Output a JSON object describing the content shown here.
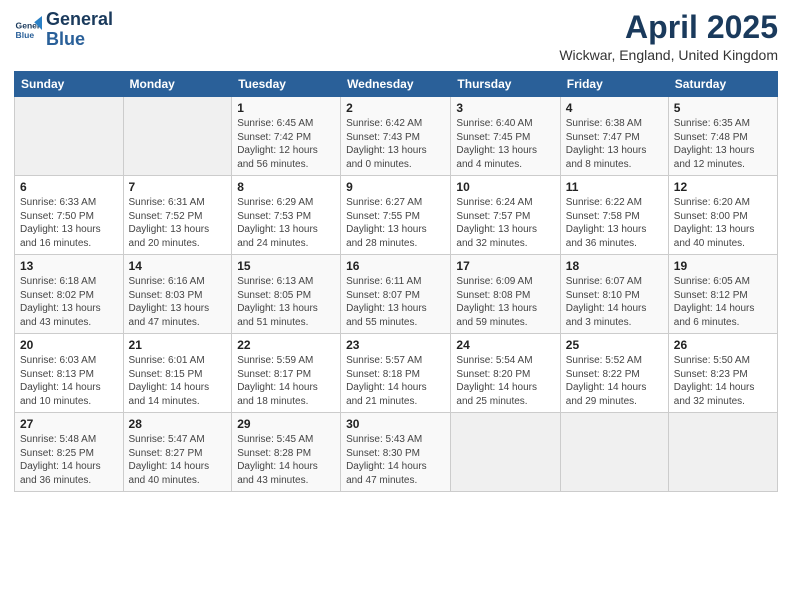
{
  "header": {
    "logo_line1": "General",
    "logo_line2": "Blue",
    "title": "April 2025",
    "subtitle": "Wickwar, England, United Kingdom"
  },
  "days_of_week": [
    "Sunday",
    "Monday",
    "Tuesday",
    "Wednesday",
    "Thursday",
    "Friday",
    "Saturday"
  ],
  "weeks": [
    [
      {
        "day": "",
        "info": ""
      },
      {
        "day": "",
        "info": ""
      },
      {
        "day": "1",
        "info": "Sunrise: 6:45 AM\nSunset: 7:42 PM\nDaylight: 12 hours\nand 56 minutes."
      },
      {
        "day": "2",
        "info": "Sunrise: 6:42 AM\nSunset: 7:43 PM\nDaylight: 13 hours\nand 0 minutes."
      },
      {
        "day": "3",
        "info": "Sunrise: 6:40 AM\nSunset: 7:45 PM\nDaylight: 13 hours\nand 4 minutes."
      },
      {
        "day": "4",
        "info": "Sunrise: 6:38 AM\nSunset: 7:47 PM\nDaylight: 13 hours\nand 8 minutes."
      },
      {
        "day": "5",
        "info": "Sunrise: 6:35 AM\nSunset: 7:48 PM\nDaylight: 13 hours\nand 12 minutes."
      }
    ],
    [
      {
        "day": "6",
        "info": "Sunrise: 6:33 AM\nSunset: 7:50 PM\nDaylight: 13 hours\nand 16 minutes."
      },
      {
        "day": "7",
        "info": "Sunrise: 6:31 AM\nSunset: 7:52 PM\nDaylight: 13 hours\nand 20 minutes."
      },
      {
        "day": "8",
        "info": "Sunrise: 6:29 AM\nSunset: 7:53 PM\nDaylight: 13 hours\nand 24 minutes."
      },
      {
        "day": "9",
        "info": "Sunrise: 6:27 AM\nSunset: 7:55 PM\nDaylight: 13 hours\nand 28 minutes."
      },
      {
        "day": "10",
        "info": "Sunrise: 6:24 AM\nSunset: 7:57 PM\nDaylight: 13 hours\nand 32 minutes."
      },
      {
        "day": "11",
        "info": "Sunrise: 6:22 AM\nSunset: 7:58 PM\nDaylight: 13 hours\nand 36 minutes."
      },
      {
        "day": "12",
        "info": "Sunrise: 6:20 AM\nSunset: 8:00 PM\nDaylight: 13 hours\nand 40 minutes."
      }
    ],
    [
      {
        "day": "13",
        "info": "Sunrise: 6:18 AM\nSunset: 8:02 PM\nDaylight: 13 hours\nand 43 minutes."
      },
      {
        "day": "14",
        "info": "Sunrise: 6:16 AM\nSunset: 8:03 PM\nDaylight: 13 hours\nand 47 minutes."
      },
      {
        "day": "15",
        "info": "Sunrise: 6:13 AM\nSunset: 8:05 PM\nDaylight: 13 hours\nand 51 minutes."
      },
      {
        "day": "16",
        "info": "Sunrise: 6:11 AM\nSunset: 8:07 PM\nDaylight: 13 hours\nand 55 minutes."
      },
      {
        "day": "17",
        "info": "Sunrise: 6:09 AM\nSunset: 8:08 PM\nDaylight: 13 hours\nand 59 minutes."
      },
      {
        "day": "18",
        "info": "Sunrise: 6:07 AM\nSunset: 8:10 PM\nDaylight: 14 hours\nand 3 minutes."
      },
      {
        "day": "19",
        "info": "Sunrise: 6:05 AM\nSunset: 8:12 PM\nDaylight: 14 hours\nand 6 minutes."
      }
    ],
    [
      {
        "day": "20",
        "info": "Sunrise: 6:03 AM\nSunset: 8:13 PM\nDaylight: 14 hours\nand 10 minutes."
      },
      {
        "day": "21",
        "info": "Sunrise: 6:01 AM\nSunset: 8:15 PM\nDaylight: 14 hours\nand 14 minutes."
      },
      {
        "day": "22",
        "info": "Sunrise: 5:59 AM\nSunset: 8:17 PM\nDaylight: 14 hours\nand 18 minutes."
      },
      {
        "day": "23",
        "info": "Sunrise: 5:57 AM\nSunset: 8:18 PM\nDaylight: 14 hours\nand 21 minutes."
      },
      {
        "day": "24",
        "info": "Sunrise: 5:54 AM\nSunset: 8:20 PM\nDaylight: 14 hours\nand 25 minutes."
      },
      {
        "day": "25",
        "info": "Sunrise: 5:52 AM\nSunset: 8:22 PM\nDaylight: 14 hours\nand 29 minutes."
      },
      {
        "day": "26",
        "info": "Sunrise: 5:50 AM\nSunset: 8:23 PM\nDaylight: 14 hours\nand 32 minutes."
      }
    ],
    [
      {
        "day": "27",
        "info": "Sunrise: 5:48 AM\nSunset: 8:25 PM\nDaylight: 14 hours\nand 36 minutes."
      },
      {
        "day": "28",
        "info": "Sunrise: 5:47 AM\nSunset: 8:27 PM\nDaylight: 14 hours\nand 40 minutes."
      },
      {
        "day": "29",
        "info": "Sunrise: 5:45 AM\nSunset: 8:28 PM\nDaylight: 14 hours\nand 43 minutes."
      },
      {
        "day": "30",
        "info": "Sunrise: 5:43 AM\nSunset: 8:30 PM\nDaylight: 14 hours\nand 47 minutes."
      },
      {
        "day": "",
        "info": ""
      },
      {
        "day": "",
        "info": ""
      },
      {
        "day": "",
        "info": ""
      }
    ]
  ]
}
